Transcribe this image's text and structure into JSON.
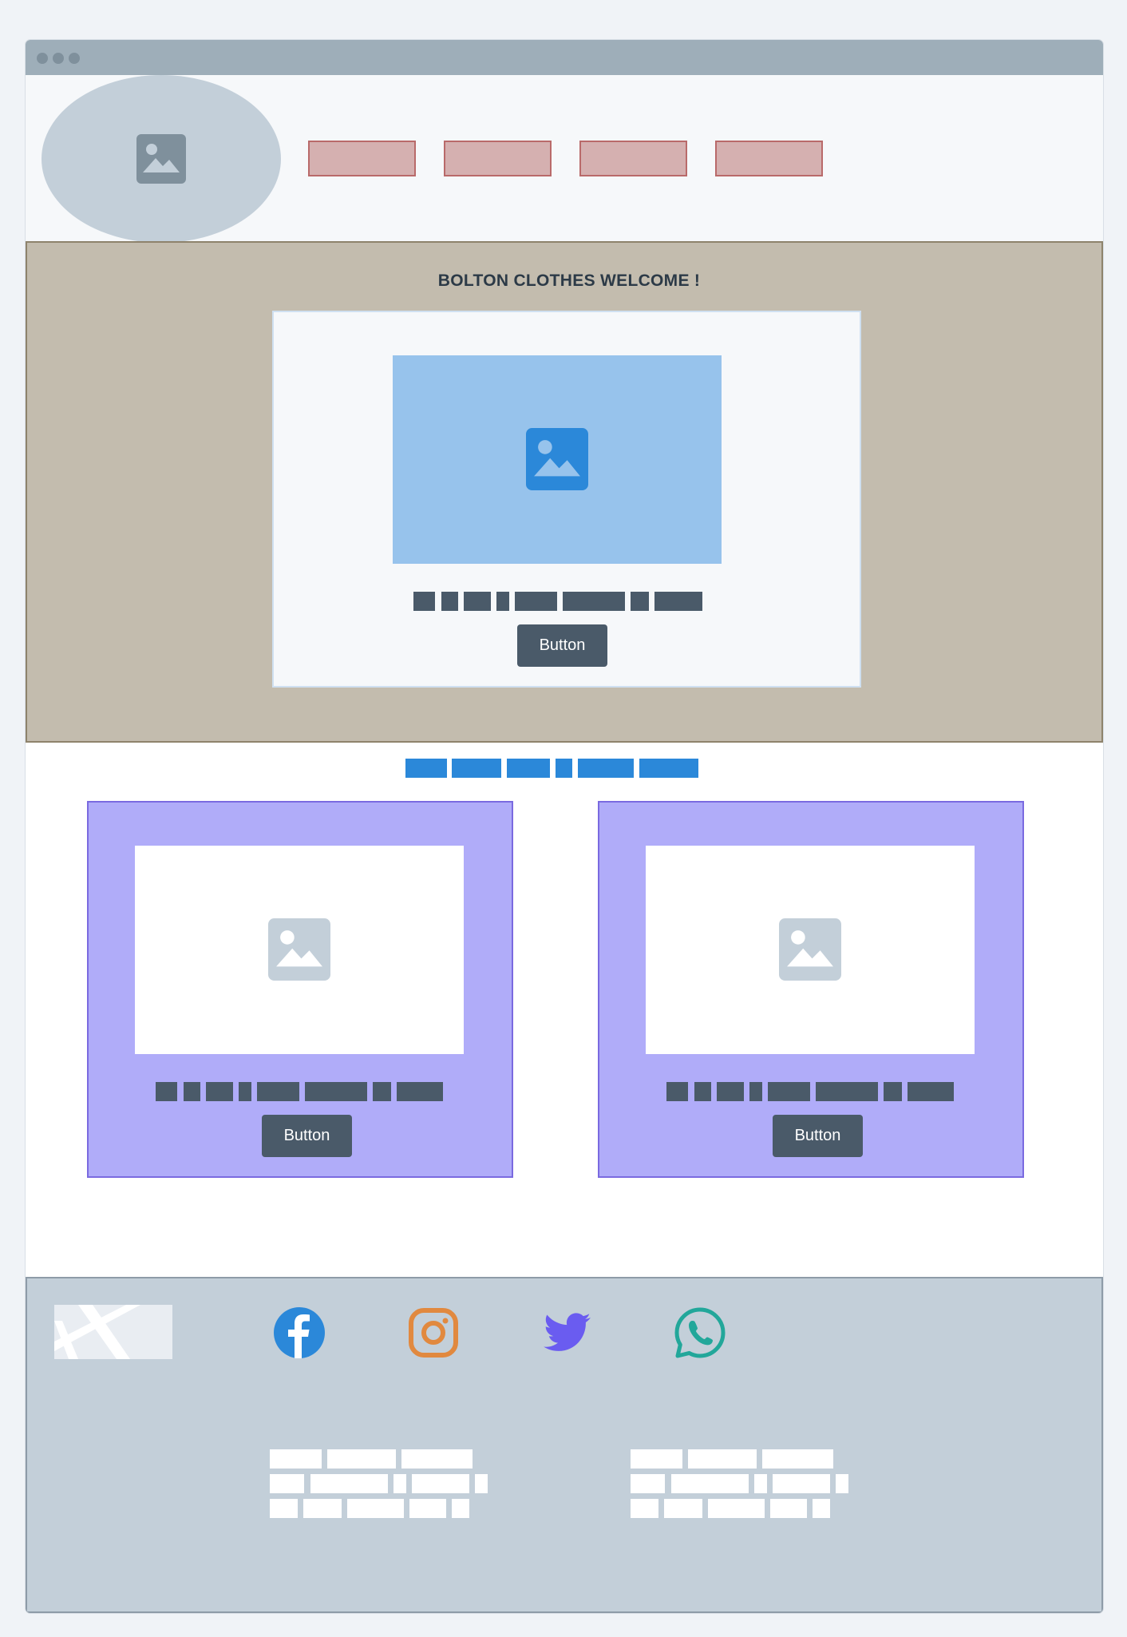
{
  "hero": {
    "title": "BOLTON CLOTHES WELCOME !",
    "card": {
      "button_label": "Button"
    }
  },
  "products": {
    "cards": [
      {
        "button_label": "Button"
      },
      {
        "button_label": "Button"
      }
    ]
  },
  "footer": {
    "social": [
      "facebook-icon",
      "instagram-icon",
      "twitter-icon",
      "whatsapp-icon"
    ]
  },
  "colors": {
    "nav_button": "#d5b0b0",
    "hero_background": "#c3bcae",
    "card_background": "#b0acf9",
    "accent_blue": "#2b88d9",
    "footer_background": "#c3cfd9",
    "facebook": "#2b88d9",
    "instagram": "#e1893f",
    "twitter": "#6a5cf0",
    "whatsapp": "#22a79a"
  }
}
